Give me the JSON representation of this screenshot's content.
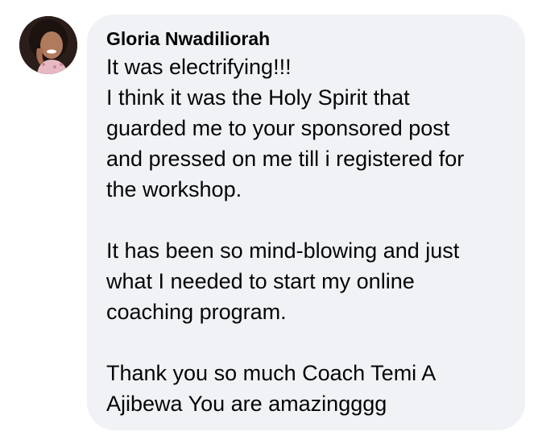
{
  "comment": {
    "author": "Gloria Nwadiliorah",
    "paragraphs": [
      [
        "It was electrifying!!!",
        "I think it was the Holy Spirit that",
        "guarded me to your sponsored post",
        "and pressed on me till i registered for",
        "the workshop."
      ],
      [
        "It has been so mind-blowing and just",
        "what I needed to start my online",
        "coaching program."
      ],
      [
        "Thank you so much Coach Temi A",
        "Ajibewa You are amazingggg"
      ]
    ]
  },
  "avatar": {
    "icon": "profile-photo",
    "description": "profile-photo"
  },
  "colors": {
    "bubble_background": "#f0f2f5",
    "text": "#050505"
  }
}
